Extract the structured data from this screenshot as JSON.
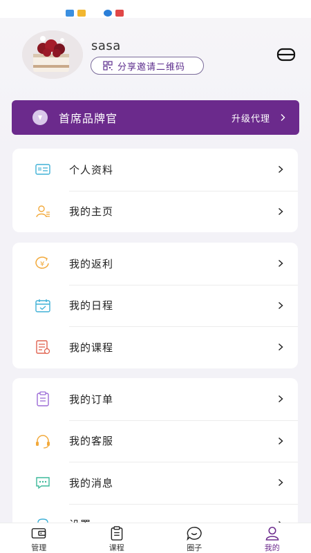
{
  "colors": {
    "brand_purple": "#6b2a8c",
    "page_bg": "#f3f2f7",
    "card_bg": "#ffffff"
  },
  "profile": {
    "username": "sasa",
    "invite_button_label": "分享邀请二维码",
    "avatar_icon": "cake-photo-avatar",
    "menu_icon": "switch-card-icon"
  },
  "brand": {
    "title": "首席品牌官",
    "action_label": "升级代理",
    "icon": "crown-icon"
  },
  "groups": [
    {
      "items": [
        {
          "label": "个人资料",
          "icon": "id-card-icon"
        },
        {
          "label": "我的主页",
          "icon": "user-list-icon"
        }
      ]
    },
    {
      "items": [
        {
          "label": "我的返利",
          "icon": "yen-rebate-icon"
        },
        {
          "label": "我的日程",
          "icon": "calendar-icon"
        },
        {
          "label": "我的课程",
          "icon": "course-doc-icon"
        }
      ]
    },
    {
      "items": [
        {
          "label": "我的订单",
          "icon": "order-clipboard-icon"
        },
        {
          "label": "我的客服",
          "icon": "headset-icon"
        },
        {
          "label": "我的消息",
          "icon": "message-icon"
        },
        {
          "label": "设置",
          "icon": "settings-icon"
        }
      ]
    }
  ],
  "tabs": [
    {
      "label": "管理",
      "icon": "wallet-icon"
    },
    {
      "label": "课程",
      "icon": "clipboard-icon"
    },
    {
      "label": "圈子",
      "icon": "chat-smile-icon"
    },
    {
      "label": "我的",
      "icon": "profile-icon",
      "active": true
    }
  ]
}
